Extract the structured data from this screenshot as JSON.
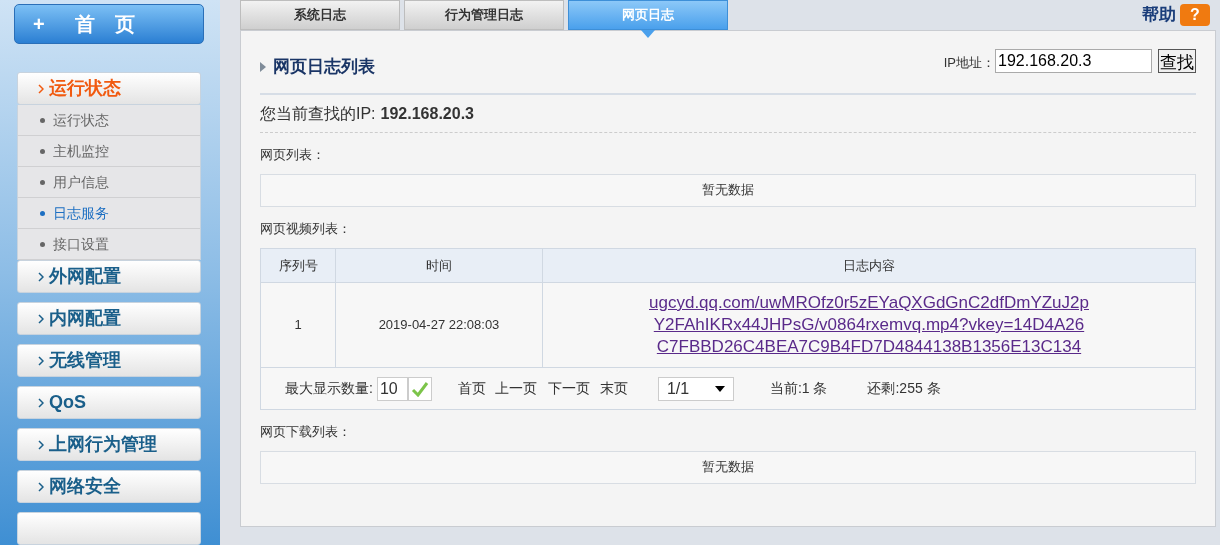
{
  "sidebar": {
    "home": {
      "icon": "+",
      "label": "首　页"
    },
    "groups": [
      {
        "label": "运行状态",
        "expanded": true,
        "items": [
          {
            "label": "运行状态",
            "selected": false
          },
          {
            "label": "主机监控",
            "selected": false
          },
          {
            "label": "用户信息",
            "selected": false
          },
          {
            "label": "日志服务",
            "selected": true
          },
          {
            "label": "接口设置",
            "selected": false
          }
        ]
      },
      {
        "label": "外网配置",
        "expanded": false
      },
      {
        "label": "内网配置",
        "expanded": false
      },
      {
        "label": "无线管理",
        "expanded": false
      },
      {
        "label": "QoS",
        "expanded": false
      },
      {
        "label": "上网行为管理",
        "expanded": false
      },
      {
        "label": "网络安全",
        "expanded": false
      },
      {
        "expanded": false
      }
    ]
  },
  "tabs": [
    {
      "label": "系统日志",
      "selected": false
    },
    {
      "label": "行为管理日志",
      "selected": false
    },
    {
      "label": "网页日志",
      "selected": true
    }
  ],
  "help": {
    "label": "帮助",
    "icon": "?"
  },
  "panel": {
    "title": "网页日志列表",
    "ip_label": "IP地址：",
    "ip_value": "192.168.20.3",
    "search_button": "查找",
    "current_ip_label": "您当前查找的IP:",
    "current_ip": "192.168.20.3",
    "web_list": {
      "title": "网页列表：",
      "empty": "暂无数据"
    },
    "video_list": {
      "title": "网页视频列表：",
      "columns": [
        "序列号",
        "时间",
        "日志内容"
      ],
      "rows": [
        {
          "index": "1",
          "time": "2019-04-27 22:08:03",
          "content_lines": [
            "ugcyd.qq.com/uwMROfz0r5zEYaQXGdGnC2dfDmYZuJ2p",
            "Y2FAhIKRx44JHPsG/v0864rxemvq.mp4?vkey=14D4A26",
            "C7FBBD26C4BEA7C9B4FD7D4844138B1356E13C134"
          ]
        }
      ],
      "pager": {
        "max_label": "最大显示数量:",
        "max_value": "10",
        "first": "首页",
        "prev": "上一页",
        "next": "下一页",
        "last": "末页",
        "page": "1/1",
        "current": "当前:1 条",
        "remaining": "还剩:255 条"
      }
    },
    "download_list": {
      "title": "网页下载列表：",
      "empty": "暂无数据"
    }
  }
}
